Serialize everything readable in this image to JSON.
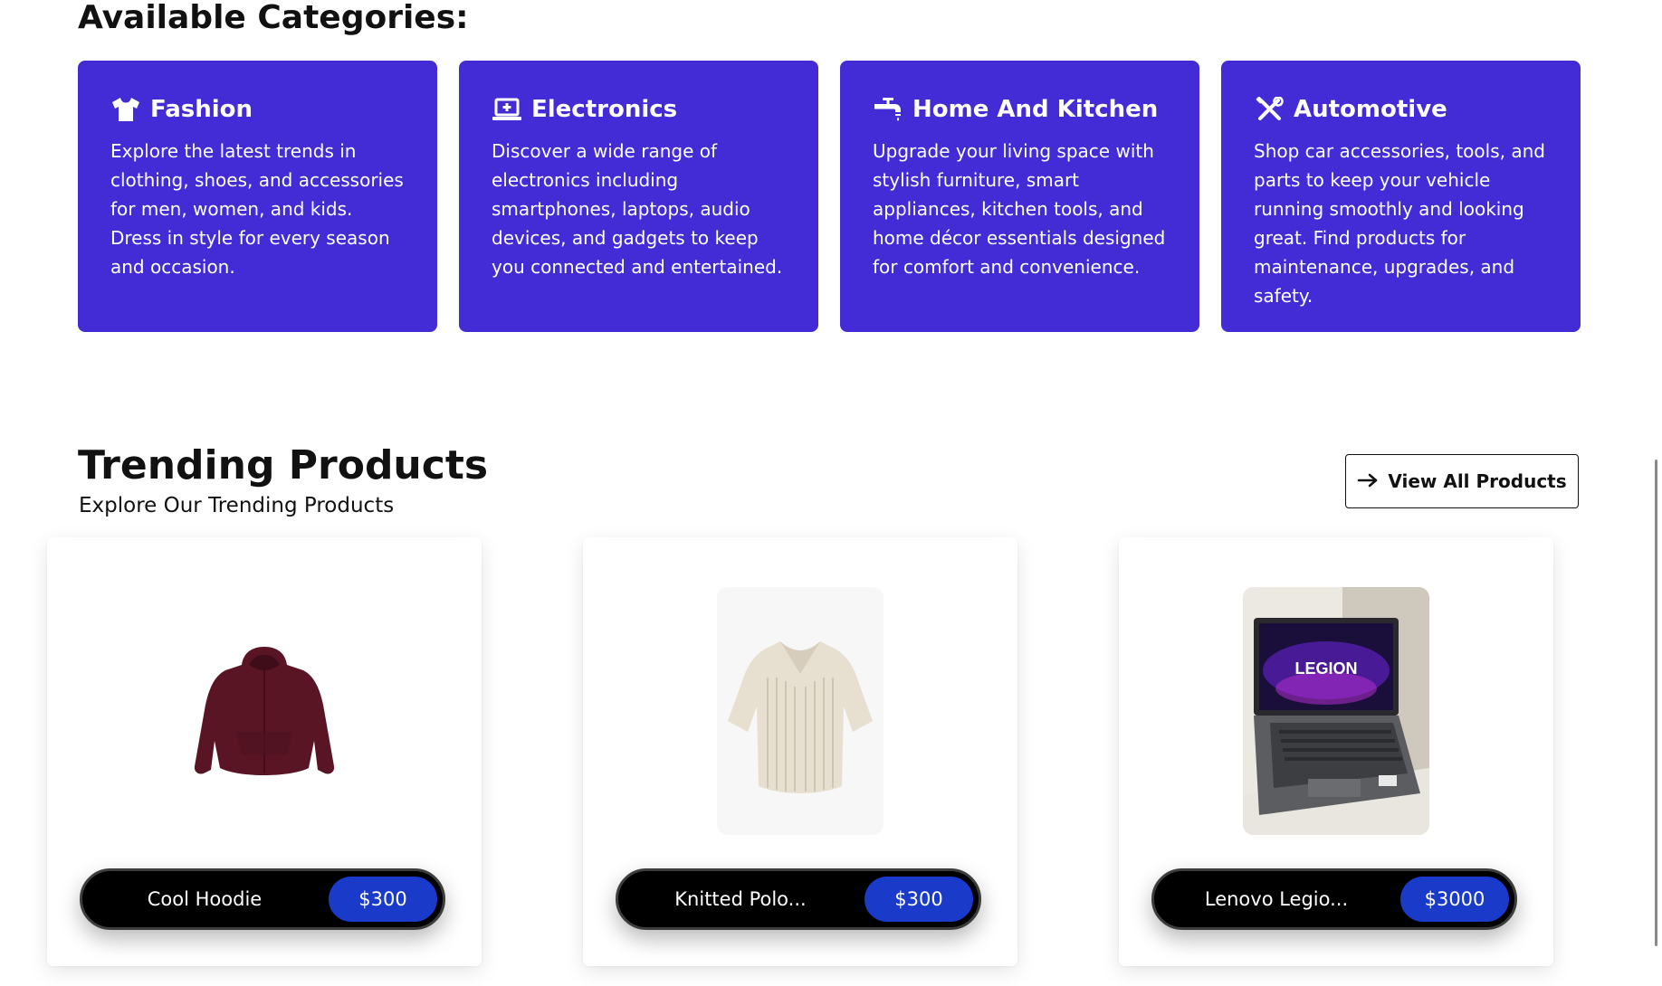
{
  "categories_section": {
    "heading": "Available Categories:",
    "items": [
      {
        "title": "Fashion",
        "icon": "shirt-icon",
        "description": "Explore the latest trends in clothing, shoes, and accessories for men, women, and kids. Dress in style for every season and occasion."
      },
      {
        "title": "Electronics",
        "icon": "laptop-icon",
        "description": "Discover a wide range of electronics including smartphones, laptops, audio devices, and gadgets to keep you connected and entertained."
      },
      {
        "title": "Home And Kitchen",
        "icon": "faucet-icon",
        "description": "Upgrade your living space with stylish furniture, smart appliances, kitchen tools, and home décor essentials designed for comfort and convenience."
      },
      {
        "title": "Automotive",
        "icon": "tools-icon",
        "description": "Shop car accessories, tools, and parts to keep your vehicle running smoothly and looking great. Find products for maintenance, upgrades, and safety."
      }
    ],
    "card_color": "#432bd6"
  },
  "trending_section": {
    "title": "Trending Products",
    "subtitle": "Explore Our Trending Products",
    "view_all_label": "View All Products",
    "view_all_icon": "arrow-right-icon",
    "products": [
      {
        "name": "Cool Hoodie",
        "price": "$300",
        "image": "maroon-hoodie-image"
      },
      {
        "name": "Knitted Polo...",
        "price": "$300",
        "image": "cream-knit-polo-image"
      },
      {
        "name": "Lenovo Legio...",
        "price": "$3000",
        "image": "legion-laptop-image"
      }
    ],
    "price_color": "#1a3ac9"
  }
}
